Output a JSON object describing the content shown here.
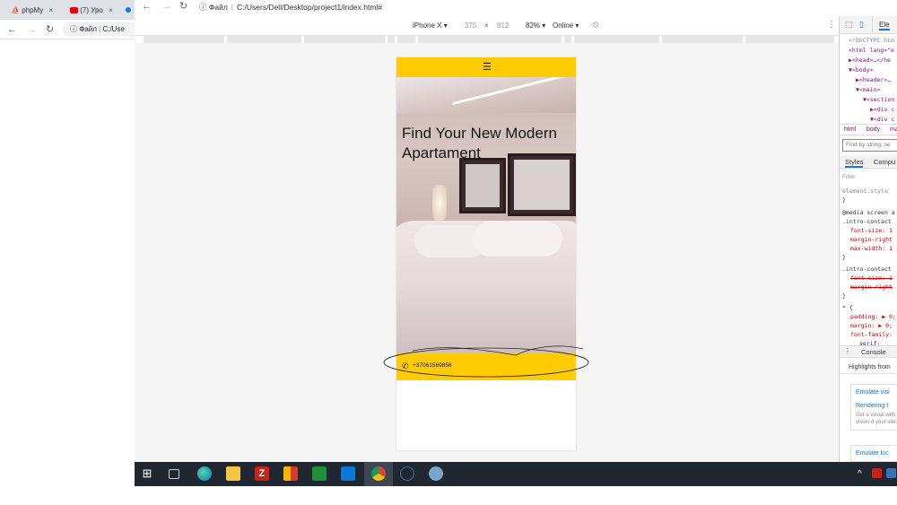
{
  "bg_browser": {
    "tabs": [
      {
        "label": "phpMy",
        "icon": "pma-icon"
      },
      {
        "label": "(7) Уро",
        "icon": "youtube-icon"
      }
    ],
    "close_glyph": "×",
    "address_label": "Файл",
    "address_text": "C:/Use"
  },
  "main_window": {
    "address_label": "Файл",
    "address_text": "C:/Users/Dell/Desktop/project1/index.html#"
  },
  "device_toolbar": {
    "device": "iPhone X ▾",
    "width": "375",
    "times": "×",
    "height": "812",
    "zoom": "82% ▾",
    "network": "Online ▾"
  },
  "site": {
    "menu_glyph": "☰",
    "hero_title": "Find Your New Modern Apartament",
    "phone_glyph": "✆",
    "phone_number": "+37061569856"
  },
  "devtools": {
    "tab_label": "Ele",
    "dom": {
      "doctype": "<!DOCTYPE htm",
      "html": "<html lang=\"e",
      "head": "▶<head>…</he",
      "body": "▼<body>",
      "header": "▶<header>…",
      "main": "▼<main>",
      "section": "▼<section",
      "div1": "▶<div c",
      "div2": "▼<div c"
    },
    "crumbs": [
      "html",
      "body",
      "ma"
    ],
    "find_placeholder": "Find by string, se",
    "styles_tab": "Styles",
    "computed_tab": "Compu",
    "filter_placeholder": "Filter",
    "rules": [
      "element.style",
      "}",
      "@media screen a",
      ".intro-contact",
      "font-size: 1",
      "margin-right",
      "max-width: 1",
      "}",
      ".intro-contact",
      "font-size: 1",
      "margin-right",
      "}",
      "* {",
      "padding: ▶ 0;",
      "margin: ▶ 0;",
      "font-family:",
      "serif;"
    ],
    "console_label": "Console",
    "highlights_label": "Highlights from",
    "cards": [
      {
        "title": "Emulate visi",
        "title2": "Rendering t",
        "sub": "Get a visual with vision d your site."
      },
      {
        "title": "Emulate loc",
        "title2": "",
        "sub": ""
      }
    ]
  },
  "taskbar": {
    "start_glyph": "⊞",
    "tray_chevron": "^"
  },
  "colors": {
    "accent_yellow": "#ffcb05",
    "taskbar": "#202730"
  }
}
